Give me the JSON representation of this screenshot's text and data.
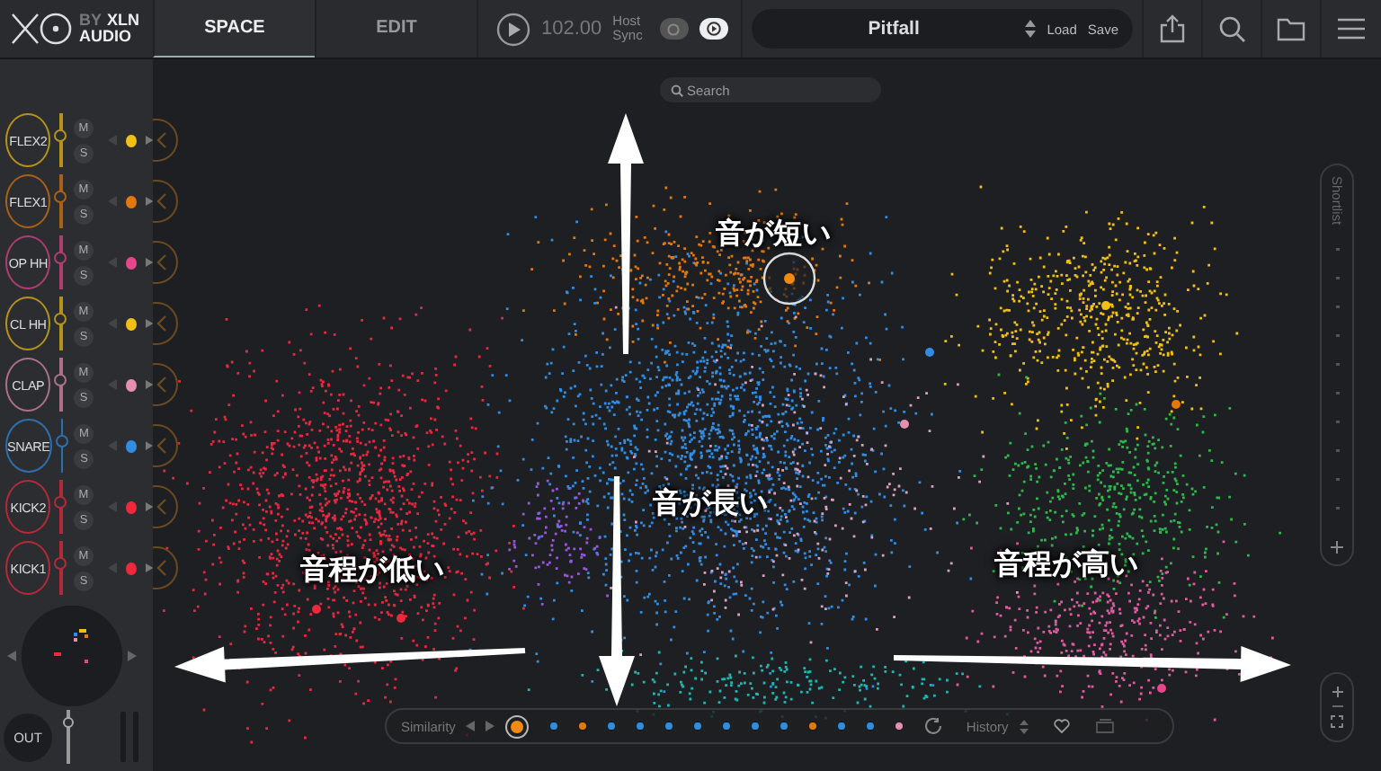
{
  "header": {
    "logo": {
      "by": "BY",
      "brand": "XLN",
      "sub": "AUDIO"
    },
    "tabs": [
      {
        "label": "SPACE",
        "selected": true
      },
      {
        "label": "EDIT",
        "selected": false
      }
    ],
    "tempo": "102.00",
    "host_sync": {
      "label": "Host Sync",
      "on": false
    },
    "preset": {
      "name": "Pitfall",
      "load": "Load",
      "save": "Save"
    }
  },
  "search": {
    "placeholder": "Search"
  },
  "channels": [
    {
      "name": "FLEX2",
      "color": "#f2c014",
      "level": 0.6,
      "mute": "M",
      "solo": "S"
    },
    {
      "name": "FLEX1",
      "color": "#e4780c",
      "level": 0.6,
      "mute": "M",
      "solo": "S"
    },
    {
      "name": "OP HH",
      "color": "#e8468c",
      "level": 0.6,
      "mute": "M",
      "solo": "S"
    },
    {
      "name": "CL HH",
      "color": "#f2c014",
      "level": 0.6,
      "mute": "M",
      "solo": "S"
    },
    {
      "name": "CLAP",
      "color": "#e58fb0",
      "level": 0.6,
      "mute": "M",
      "solo": "S"
    },
    {
      "name": "SNARE",
      "color": "#2f8de4",
      "level": 0.6,
      "mute": "M",
      "solo": "S"
    },
    {
      "name": "KICK2",
      "color": "#f0283c",
      "level": 0.6,
      "mute": "M",
      "solo": "S"
    },
    {
      "name": "KICK1",
      "color": "#f0283c",
      "level": 0.6,
      "mute": "M",
      "solo": "S"
    }
  ],
  "output": {
    "label": "OUT",
    "level": 0.85
  },
  "annotations": [
    {
      "text": "音が短い"
    },
    {
      "text": "音が長い"
    },
    {
      "text": "音程が低い"
    },
    {
      "text": "音程が高い"
    }
  ],
  "similarity": {
    "label": "Similarity",
    "history": "History",
    "items": [
      {
        "color": "#f08a10",
        "selected": true
      },
      {
        "color": "#2f8de4",
        "selected": false
      },
      {
        "color": "#e4780c",
        "selected": false
      },
      {
        "color": "#2f8de4",
        "selected": false
      },
      {
        "color": "#2f8de4",
        "selected": false
      },
      {
        "color": "#2f8de4",
        "selected": false
      },
      {
        "color": "#2f8de4",
        "selected": false
      },
      {
        "color": "#2f8de4",
        "selected": false
      },
      {
        "color": "#2f8de4",
        "selected": false
      },
      {
        "color": "#2f8de4",
        "selected": false
      },
      {
        "color": "#e4780c",
        "selected": false
      },
      {
        "color": "#2f8de4",
        "selected": false
      },
      {
        "color": "#2f8de4",
        "selected": false
      },
      {
        "color": "#e58fb0",
        "selected": false
      }
    ]
  },
  "shortlist": {
    "label": "Shortlist"
  }
}
